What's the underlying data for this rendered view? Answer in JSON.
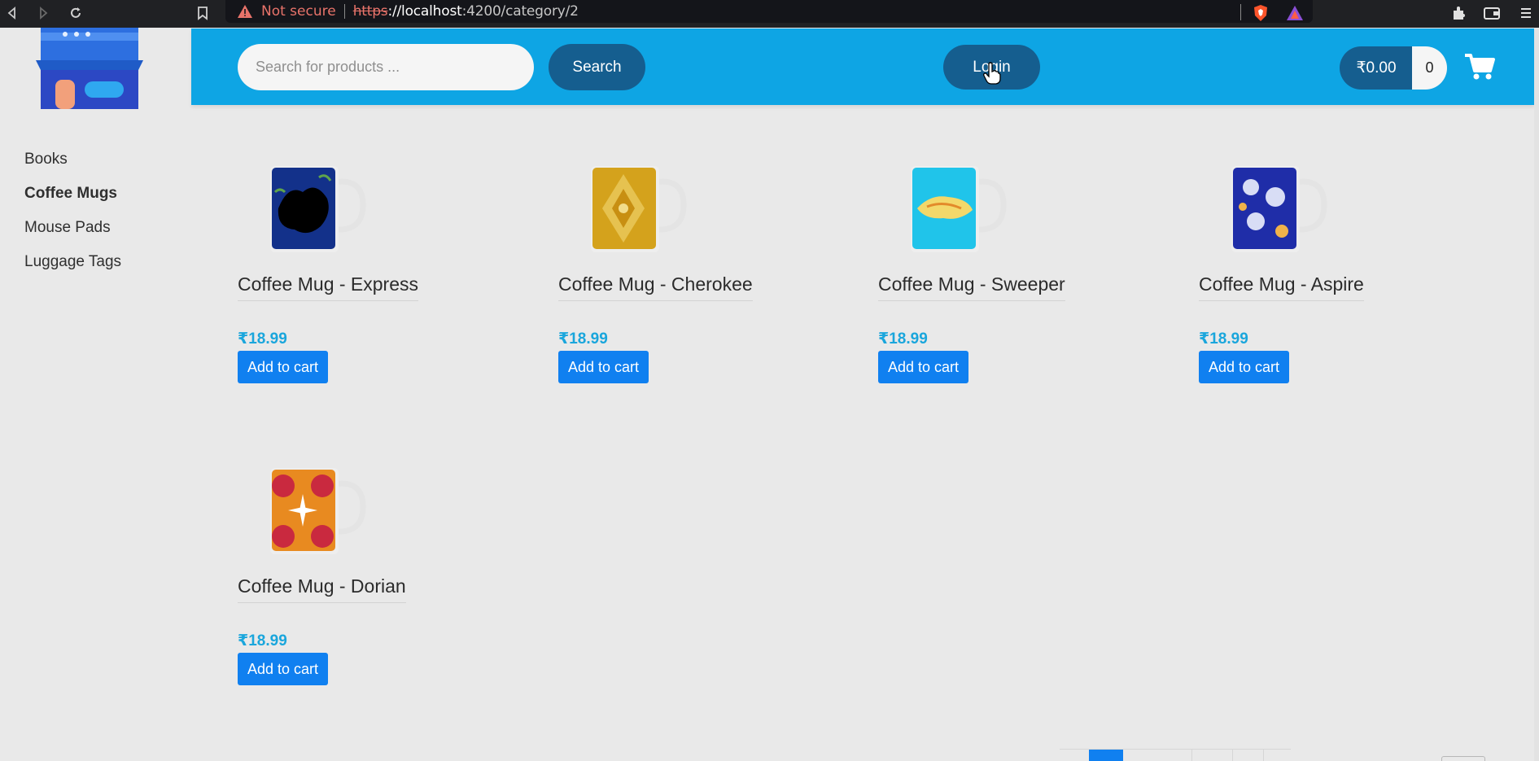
{
  "browser": {
    "not_secure_label": "Not secure",
    "url_scheme": "https",
    "url_host": "://localhost",
    "url_rest": ":4200/category/2"
  },
  "header": {
    "search_placeholder": "Search for products ...",
    "search_label": "Search",
    "login_label": "Login",
    "cart_total": "₹0.00",
    "cart_count": "0",
    "header_color": "#0ea5e4",
    "button_color": "#155e8f"
  },
  "sidebar": {
    "items": [
      {
        "label": "Books",
        "active": false
      },
      {
        "label": "Coffee Mugs",
        "active": true
      },
      {
        "label": "Mouse Pads",
        "active": false
      },
      {
        "label": "Luggage Tags",
        "active": false
      }
    ]
  },
  "products": [
    {
      "name": "Coffee Mug - Express",
      "price": "₹18.99",
      "button": "Add to cart"
    },
    {
      "name": "Coffee Mug - Cherokee",
      "price": "₹18.99",
      "button": "Add to cart"
    },
    {
      "name": "Coffee Mug - Sweeper",
      "price": "₹18.99",
      "button": "Add to cart"
    },
    {
      "name": "Coffee Mug - Aspire",
      "price": "₹18.99",
      "button": "Add to cart"
    },
    {
      "name": "Coffee Mug - Dorian",
      "price": "₹18.99",
      "button": "Add to cart"
    }
  ]
}
